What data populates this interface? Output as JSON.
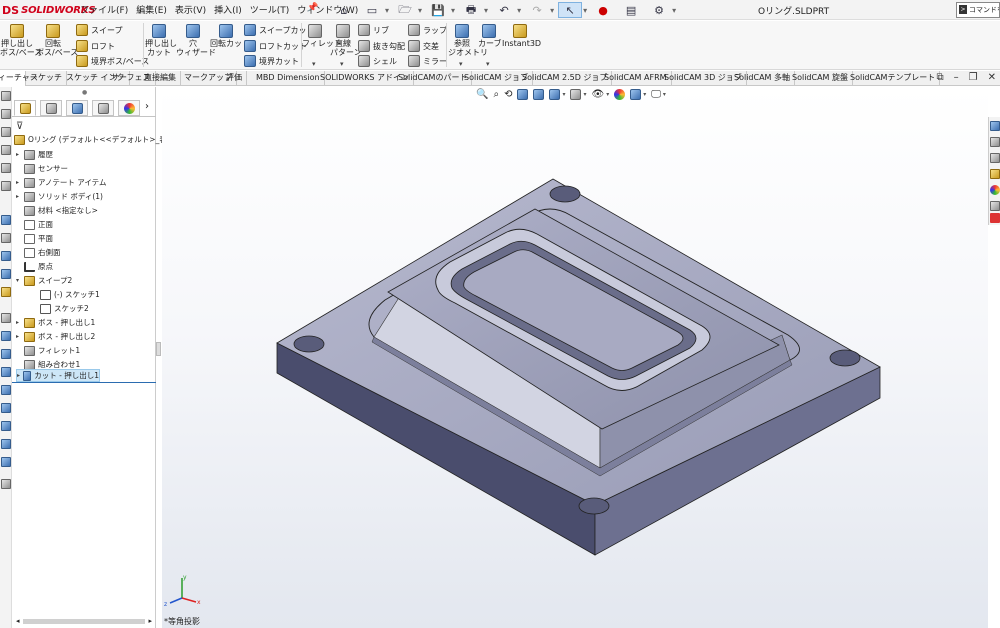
{
  "app": {
    "logo_ds": "DS",
    "logo_text": "SOLIDWORKS",
    "document_title": "Oリング.SLDPRT",
    "command_search_placeholder": "コマンドを検索"
  },
  "menu": [
    "ファイル(F)",
    "編集(E)",
    "表示(V)",
    "挿入(I)",
    "ツール(T)",
    "ウィンドウ(W)"
  ],
  "ribbon": {
    "boss_extrude": [
      "押し出し",
      "ボス/ベース"
    ],
    "revolve_boss": [
      "回転",
      "ボス/ベース"
    ],
    "sweep": "スイープ",
    "loft": "ロフト",
    "boundary_boss": "境界ボス/ベース",
    "extrude_cut": [
      "押し出し",
      "カット"
    ],
    "hole_wizard": [
      "穴",
      "ウィザード"
    ],
    "revolve_cut": "回転カット",
    "swept_cut": "スイープカット",
    "lofted_cut": "ロフトカット",
    "boundary_cut": "境界カット",
    "fillet": "フィレット",
    "linear_pattern": [
      "直線",
      "パターン"
    ],
    "rib": "リブ",
    "draft": "抜き勾配",
    "shell": "シェル",
    "wrap": "ラップ",
    "intersect": "交差",
    "mirror": "ミラー",
    "ref_geometry": [
      "参照",
      "ジオメトリ"
    ],
    "curves": "カーブ",
    "instant3d": "Instant3D"
  },
  "tabs": [
    "フィーチャー",
    "スケッチ",
    "スケッチ インク",
    "サーフェス",
    "直接編集",
    "マークアップ",
    "評価",
    "MBD Dimension",
    "SOLIDWORKS アドイン",
    "SolidCAMのパート",
    "SolidCAM ジョブ",
    "SolidCAM 2.5D ジョブ",
    "SolidCAM AFRM",
    "SolidCAM 3D ジョブ",
    "SolidCAM 多軸",
    "SolidCAM 旋盤",
    "SolidCAMテンプレート"
  ],
  "tree": {
    "root": "Oリング (デフォルト<<デフォルト>_表示状態",
    "items": [
      {
        "label": "履歴"
      },
      {
        "label": "センサー"
      },
      {
        "label": "アノテート アイテム"
      },
      {
        "label": "ソリッド ボディ(1)"
      },
      {
        "label": "材料 <指定なし>"
      },
      {
        "label": "正面"
      },
      {
        "label": "平面"
      },
      {
        "label": "右側面"
      },
      {
        "label": "原点"
      },
      {
        "label": "スイープ2"
      },
      {
        "label": "(-) スケッチ1"
      },
      {
        "label": "スケッチ2"
      },
      {
        "label": "ボス - 押し出し1"
      },
      {
        "label": "ボス - 押し出し2"
      },
      {
        "label": "フィレット1"
      },
      {
        "label": "組み合わせ1"
      },
      {
        "label": "カット - 押し出し1"
      }
    ]
  },
  "view": {
    "label": "*等角投影",
    "triad": [
      "x",
      "y",
      "z"
    ]
  },
  "colors": {
    "model_top": "#a6a8c0",
    "model_front": "#4a4d6d",
    "model_side": "#6d7090",
    "selection": "#cde6f7",
    "accent": "#2b6cb0"
  }
}
